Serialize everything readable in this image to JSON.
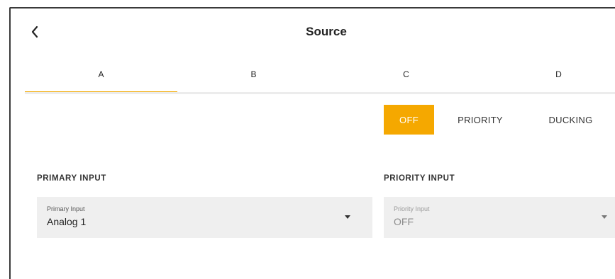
{
  "header": {
    "title": "Source",
    "back_icon": "chevron-left-icon"
  },
  "tabs": [
    {
      "label": "A",
      "active": true
    },
    {
      "label": "B",
      "active": false
    },
    {
      "label": "C",
      "active": false
    },
    {
      "label": "D",
      "active": false
    }
  ],
  "mode": {
    "options": [
      "OFF",
      "PRIORITY",
      "DUCKING"
    ],
    "selected": "OFF"
  },
  "primary": {
    "section_label": "PRIMARY INPUT",
    "field_label": "Primary Input",
    "value": "Analog 1",
    "dropdown_icon": "caret-down-icon"
  },
  "priority": {
    "section_label": "PRIORITY INPUT",
    "field_label": "Priority Input",
    "value": "OFF",
    "dropdown_icon": "caret-down-icon",
    "disabled": true
  },
  "colors": {
    "accent": "#f5a800",
    "field_background": "#efefef",
    "text": "#222222"
  }
}
